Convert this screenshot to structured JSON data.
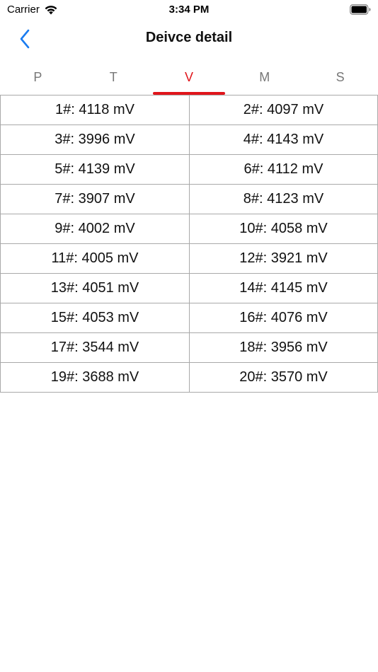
{
  "status_bar": {
    "carrier": "Carrier",
    "time": "3:34 PM",
    "icons": [
      "wifi-icon",
      "battery-icon"
    ]
  },
  "nav": {
    "title": "Deivce detail",
    "back_icon": "chevron-left-icon",
    "accent_color": "#1a7cf0"
  },
  "tabs": [
    {
      "label": "P",
      "active": false
    },
    {
      "label": "T",
      "active": false
    },
    {
      "label": "V",
      "active": true
    },
    {
      "label": "M",
      "active": false
    },
    {
      "label": "S",
      "active": false
    }
  ],
  "active_color": "#e0151b",
  "cells": [
    "1#: 4118 mV",
    "2#: 4097 mV",
    "3#: 3996 mV",
    "4#: 4143 mV",
    "5#: 4139 mV",
    "6#: 4112 mV",
    "7#: 3907 mV",
    "8#: 4123 mV",
    "9#: 4002 mV",
    "10#: 4058 mV",
    "11#: 4005 mV",
    "12#: 3921 mV",
    "13#: 4051 mV",
    "14#: 4145 mV",
    "15#: 4053 mV",
    "16#: 4076 mV",
    "17#: 3544 mV",
    "18#: 3956 mV",
    "19#: 3688 mV",
    "20#: 3570 mV"
  ]
}
